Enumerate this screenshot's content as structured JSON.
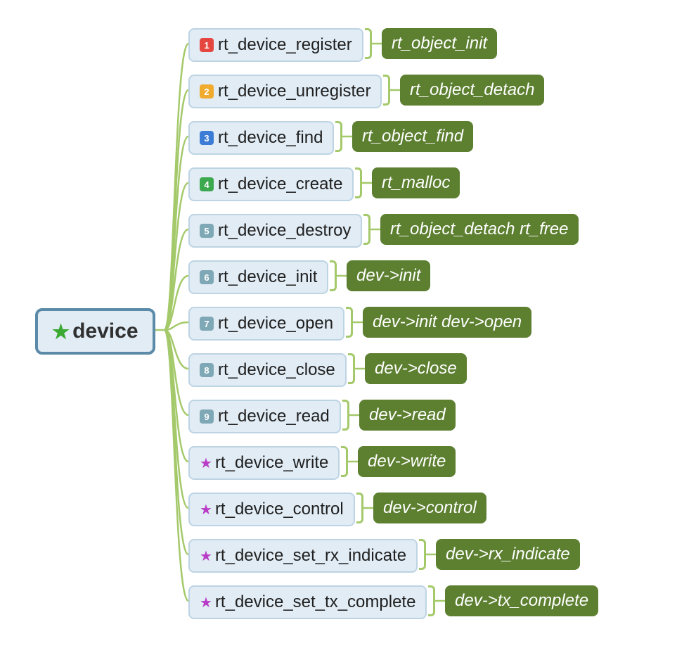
{
  "root": {
    "label": "device",
    "icon": "star-green"
  },
  "children": [
    {
      "badge": "1",
      "badgeColor": "#e64640",
      "label": "rt_device_register",
      "detail": "rt_object_init"
    },
    {
      "badge": "2",
      "badgeColor": "#f0ab2e",
      "label": "rt_device_unregister",
      "detail": "rt_object_detach"
    },
    {
      "badge": "3",
      "badgeColor": "#3b7dd6",
      "label": "rt_device_find",
      "detail": "rt_object_find"
    },
    {
      "badge": "4",
      "badgeColor": "#3ca94f",
      "label": "rt_device_create",
      "detail": "rt_malloc"
    },
    {
      "badge": "5",
      "badgeColor": "#7fa8b6",
      "label": "rt_device_destroy",
      "detail": "rt_object_detach rt_free"
    },
    {
      "badge": "6",
      "badgeColor": "#7fa8b6",
      "label": "rt_device_init",
      "detail": "dev->init"
    },
    {
      "badge": "7",
      "badgeColor": "#7fa8b6",
      "label": "rt_device_open",
      "detail": "dev->init dev->open"
    },
    {
      "badge": "8",
      "badgeColor": "#7fa8b6",
      "label": "rt_device_close",
      "detail": "dev->close"
    },
    {
      "badge": "9",
      "badgeColor": "#7fa8b6",
      "label": "rt_device_read",
      "detail": "dev->read"
    },
    {
      "badge": "★",
      "badgeColor": "star",
      "label": "rt_device_write",
      "detail": "dev->write"
    },
    {
      "badge": "★",
      "badgeColor": "star",
      "label": "rt_device_control",
      "detail": "dev->control"
    },
    {
      "badge": "★",
      "badgeColor": "star",
      "label": "rt_device_set_rx_indicate",
      "detail": "dev->rx_indicate"
    },
    {
      "badge": "★",
      "badgeColor": "star",
      "label": "rt_device_set_tx_complete",
      "detail": "dev->tx_complete"
    }
  ],
  "layout": {
    "childLeft": 248,
    "rowTop0": 20,
    "rowGap": 66,
    "rootRight": 192,
    "rootMidY": 449
  }
}
